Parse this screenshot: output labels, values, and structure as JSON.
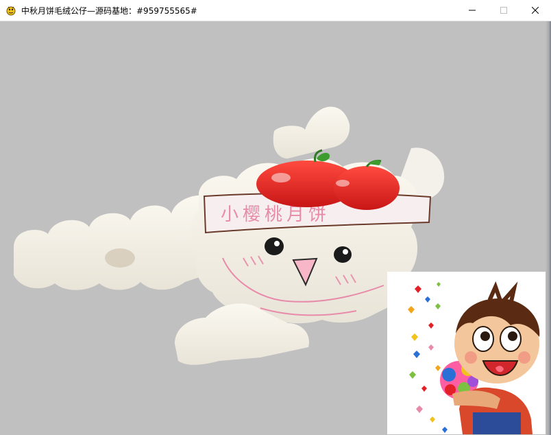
{
  "window": {
    "title": "中秋月饼毛绒公仔—源码基地：#959755565#",
    "app_icon": "pygame-snake-icon",
    "controls": {
      "minimize_icon": "minimize-icon",
      "maximize_icon": "maximize-icon",
      "close_icon": "close-icon"
    }
  },
  "scene": {
    "background_color": "#c0c0c0",
    "plush_label_text": "小樱桃月饼",
    "accent_red": "#e32028",
    "accent_pink": "#e88aa9"
  }
}
